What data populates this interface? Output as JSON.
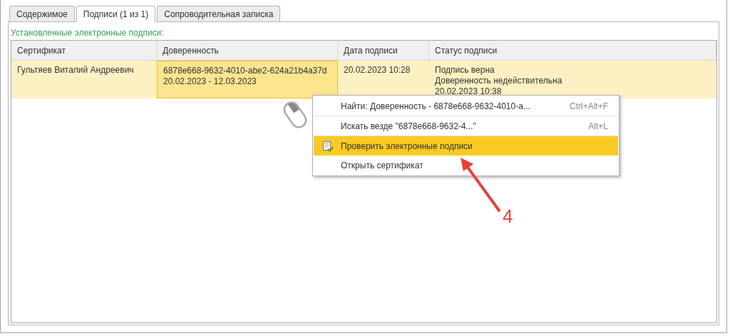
{
  "tabs": [
    {
      "label": "Содержимое",
      "selected": false
    },
    {
      "label": "Подписи (1 из 1)",
      "selected": true
    },
    {
      "label": "Сопроводительная записка",
      "selected": false
    }
  ],
  "group_title": "Установленные электронные подписи:",
  "table": {
    "columns": [
      "Сертификат",
      "Доверенность",
      "Дата подписи",
      "Статус подписи"
    ],
    "rows": [
      {
        "selected": true,
        "cells": [
          {
            "lines": [
              "Гультяев Виталий Андреевич"
            ],
            "selected": false
          },
          {
            "lines": [
              "6878e668-9632-4010-abe2-624a21b4a37d",
              "20.02.2023 - 12.03.2023"
            ],
            "selected": true
          },
          {
            "lines": [
              "20.02.2023 10:28"
            ],
            "selected": false
          },
          {
            "lines": [
              "Подпись верна",
              "Доверенность недействительна",
              "20.02.2023 10:38"
            ],
            "selected": false
          }
        ]
      }
    ]
  },
  "context_menu": {
    "items": [
      {
        "kind": "plain",
        "label": "Найти: Доверенность - 6878e668-9632-4010-a...",
        "shortcut": "Ctrl+Alt+F",
        "selected": false,
        "separator_after": true
      },
      {
        "kind": "plain",
        "label": "Искать везде \"6878e668-9632-4...\"",
        "shortcut": "Alt+L",
        "selected": false,
        "separator_after": true
      },
      {
        "kind": "icon",
        "label": "Проверить электронные подписи",
        "selected": true,
        "separator_after": false
      },
      {
        "kind": "plain",
        "label": "Открыть сертификат",
        "selected": false,
        "separator_after": false
      }
    ]
  },
  "annotation": {
    "label": "4"
  }
}
